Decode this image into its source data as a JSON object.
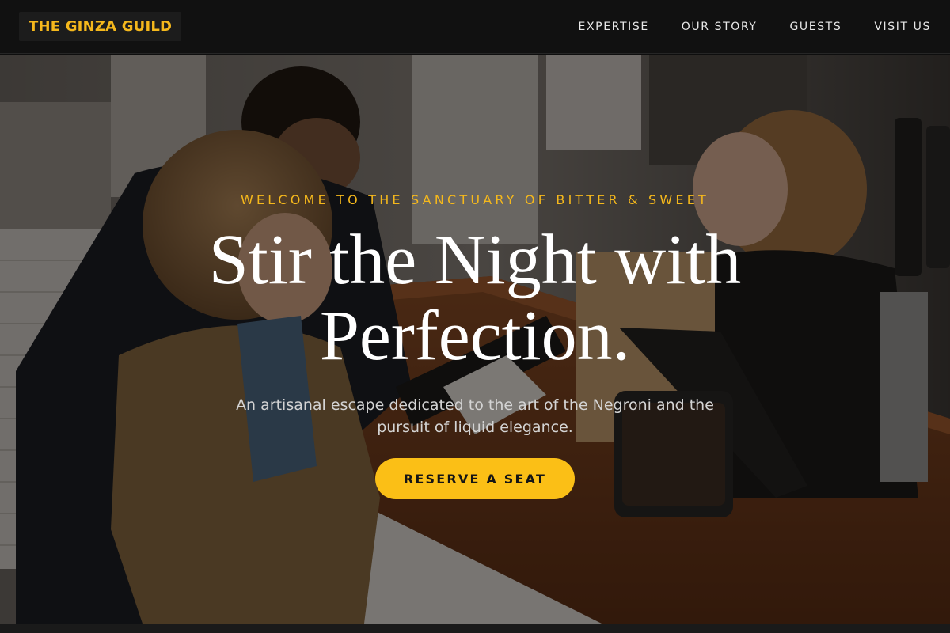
{
  "brand": {
    "name": "THE GINZA GUILD"
  },
  "nav": {
    "links": [
      "EXPERTISE",
      "OUR STORY",
      "GUESTS",
      "VISIT US"
    ]
  },
  "hero": {
    "eyebrow": "WELCOME TO THE SANCTUARY OF BITTER & SWEET",
    "headline_line1": "Stir the Night with",
    "headline_line2": "Perfection.",
    "subtext": "An artisanal escape dedicated to the art of the Negroni and the pursuit of liquid elegance.",
    "cta_label": "RESERVE A SEAT",
    "background_image": "photo of bartender serving a couple at a wine bar counter"
  },
  "colors": {
    "accent": "#f5b81c",
    "button": "#fbbf16",
    "nav_bg": "#111111"
  }
}
